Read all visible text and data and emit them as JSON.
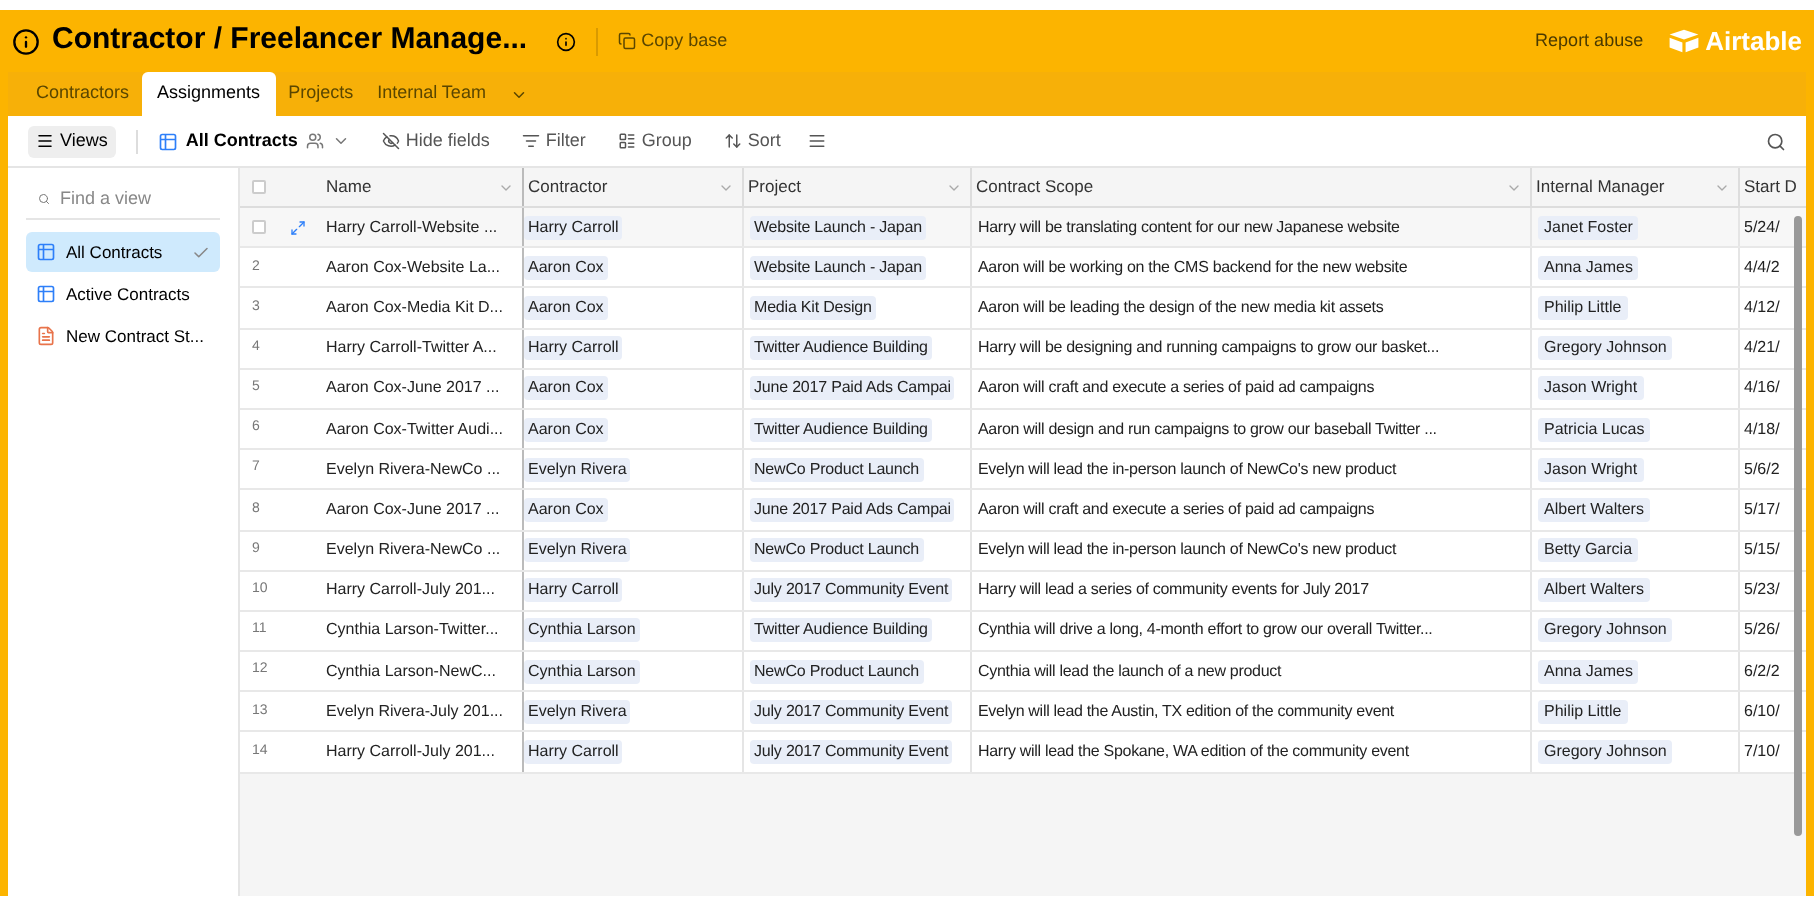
{
  "header": {
    "title": "Contractor / Freelancer Manage...",
    "copy_base": "Copy base",
    "report_abuse": "Report abuse",
    "logo_text": "Airtable"
  },
  "tabs": [
    {
      "label": "Contractors",
      "selected": false
    },
    {
      "label": "Assignments",
      "selected": true
    },
    {
      "label": "Projects",
      "selected": false
    },
    {
      "label": "Internal Team",
      "selected": false
    }
  ],
  "toolbar": {
    "views": "Views",
    "current_view": "All Contracts",
    "buttons": [
      {
        "kind": "hide",
        "label": "Hide fields"
      },
      {
        "kind": "filter",
        "label": "Filter"
      },
      {
        "kind": "group",
        "label": "Group"
      },
      {
        "kind": "sort",
        "label": "Sort"
      }
    ]
  },
  "sidebar": {
    "search_placeholder": "Find a view",
    "items": [
      {
        "kind": "grid",
        "label": "All Contracts",
        "selected": true
      },
      {
        "kind": "grid",
        "label": "Active Contracts",
        "selected": false
      },
      {
        "kind": "form",
        "label": "New Contract St...",
        "selected": false
      }
    ]
  },
  "table": {
    "all_checked": false,
    "columns": [
      "Name",
      "Contractor",
      "Project",
      "Contract Scope",
      "Internal Manager",
      "Start D"
    ],
    "rows": [
      {
        "hovered": true,
        "checked": false,
        "name": "Harry Carroll-Website ...",
        "contractor": "Harry Carroll",
        "project": "Website Launch - Japan",
        "scope": "Harry will be translating content for our new Japanese website",
        "manager": "Janet Foster",
        "start": "5/24/"
      },
      {
        "hovered": false,
        "number": "2",
        "name": "Aaron Cox-Website La...",
        "contractor": "Aaron Cox",
        "project": "Website Launch - Japan",
        "scope": "Aaron will be working on the CMS backend for the new website",
        "manager": "Anna James",
        "start": "4/4/2"
      },
      {
        "hovered": false,
        "number": "3",
        "name": "Aaron Cox-Media Kit D...",
        "contractor": "Aaron Cox",
        "project": "Media Kit Design",
        "scope": "Aaron will be leading the design of the new media kit assets",
        "manager": "Philip Little",
        "start": "4/12/"
      },
      {
        "hovered": false,
        "number": "4",
        "name": "Harry Carroll-Twitter A...",
        "contractor": "Harry Carroll",
        "project": "Twitter Audience Building",
        "scope": "Harry will be designing and running campaigns to grow our basket...",
        "manager": "Gregory Johnson",
        "start": "4/21/"
      },
      {
        "hovered": false,
        "number": "5",
        "name": "Aaron Cox-June 2017 ...",
        "contractor": "Aaron Cox",
        "project": "June 2017 Paid Ads Campai",
        "scope": "Aaron will craft and execute a series of paid ad campaigns",
        "manager": "Jason Wright",
        "start": "4/16/"
      },
      {
        "hovered": false,
        "number": "6",
        "name": "Aaron Cox-Twitter Audi...",
        "contractor": "Aaron Cox",
        "project": "Twitter Audience Building",
        "scope": "Aaron will design and run campaigns to grow our baseball Twitter ...",
        "manager": "Patricia Lucas",
        "start": "4/18/"
      },
      {
        "hovered": false,
        "number": "7",
        "name": "Evelyn Rivera-NewCo ...",
        "contractor": "Evelyn Rivera",
        "project": "NewCo Product Launch",
        "scope": "Evelyn will lead the in-person launch of NewCo's new product",
        "manager": "Jason Wright",
        "start": "5/6/2"
      },
      {
        "hovered": false,
        "number": "8",
        "name": "Aaron Cox-June 2017 ...",
        "contractor": "Aaron Cox",
        "project": "June 2017 Paid Ads Campai",
        "scope": "Aaron will craft and execute a series of paid ad campaigns",
        "manager": "Albert Walters",
        "start": "5/17/"
      },
      {
        "hovered": false,
        "number": "9",
        "name": "Evelyn Rivera-NewCo ...",
        "contractor": "Evelyn Rivera",
        "project": "NewCo Product Launch",
        "scope": "Evelyn will lead the in-person launch of NewCo's new product",
        "manager": "Betty Garcia",
        "start": "5/15/"
      },
      {
        "hovered": false,
        "number": "10",
        "name": "Harry Carroll-July 201...",
        "contractor": "Harry Carroll",
        "project": "July 2017 Community Event",
        "scope": "Harry will lead a series of community events for July 2017",
        "manager": "Albert Walters",
        "start": "5/23/"
      },
      {
        "hovered": false,
        "number": "11",
        "name": "Cynthia Larson-Twitter...",
        "contractor": "Cynthia Larson",
        "project": "Twitter Audience Building",
        "scope": "Cynthia will drive a long, 4-month effort to grow our overall Twitter...",
        "manager": "Gregory Johnson",
        "start": "5/26/"
      },
      {
        "hovered": false,
        "number": "12",
        "name": "Cynthia Larson-NewC...",
        "contractor": "Cynthia Larson",
        "project": "NewCo Product Launch",
        "scope": "Cynthia will lead the launch of a new product",
        "manager": "Anna James",
        "start": "6/2/2"
      },
      {
        "hovered": false,
        "number": "13",
        "name": "Evelyn Rivera-July 201...",
        "contractor": "Evelyn Rivera",
        "project": "July 2017 Community Event",
        "scope": "Evelyn will lead the Austin, TX edition of the community event",
        "manager": "Philip Little",
        "start": "6/10/"
      },
      {
        "hovered": false,
        "number": "14",
        "name": "Harry Carroll-July 201...",
        "contractor": "Harry Carroll",
        "project": "July 2017 Community Event",
        "scope": "Harry will lead the Spokane, WA edition of the community event",
        "manager": "Gregory Johnson",
        "start": "7/10/"
      }
    ]
  }
}
